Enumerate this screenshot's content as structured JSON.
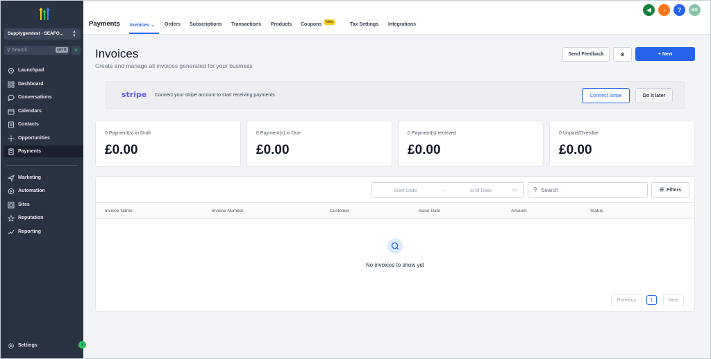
{
  "sidebar": {
    "location": "Supplygemtest - SEAFO...",
    "search_placeholder": "Search",
    "search_shortcut": "ctrl K",
    "items": [
      {
        "label": "Launchpad",
        "icon": "rocket-icon"
      },
      {
        "label": "Dashboard",
        "icon": "grid-icon"
      },
      {
        "label": "Conversations",
        "icon": "chat-icon"
      },
      {
        "label": "Calendars",
        "icon": "calendar-icon"
      },
      {
        "label": "Contacts",
        "icon": "contacts-icon"
      },
      {
        "label": "Opportunities",
        "icon": "opportunities-icon"
      },
      {
        "label": "Payments",
        "icon": "payments-icon",
        "active": true
      },
      {
        "label": "Marketing",
        "icon": "send-icon"
      },
      {
        "label": "Automation",
        "icon": "automation-icon"
      },
      {
        "label": "Sites",
        "icon": "sites-icon"
      },
      {
        "label": "Reputation",
        "icon": "star-icon"
      },
      {
        "label": "Reporting",
        "icon": "chart-line-icon"
      }
    ],
    "settings_label": "Settings"
  },
  "header": {
    "title": "Payments",
    "tabs": [
      "Invoices",
      "Orders",
      "Subscriptions",
      "Transactions",
      "Products",
      "Coupons",
      "Tax Settings",
      "Integrations"
    ],
    "new_badge": "New",
    "avatar_initials": "SG",
    "help_label": "?"
  },
  "page": {
    "title": "Invoices",
    "subtitle": "Create and manage all invoices generated for your business",
    "send_feedback": "Send Feedback",
    "new_button": "+ New"
  },
  "stripe": {
    "logo": "stripe",
    "text": "Connect your stripe account to start receiving payments",
    "connect": "Connect Stripe",
    "later": "Do it later"
  },
  "summary": [
    {
      "label": "0 Payment(s) in Draft",
      "value": "£0.00"
    },
    {
      "label": "0 Payment(s) in Due",
      "value": "£0.00"
    },
    {
      "label": "0 Payment(s) received",
      "value": "£0.00"
    },
    {
      "label": "0 Unpaid/Overdue",
      "value": "£0.00"
    }
  ],
  "table": {
    "start_date": "Start Date",
    "end_date": "End Date",
    "search_placeholder": "Search",
    "filters": "Filters",
    "columns": [
      "Invoice Name",
      "Invoice Number",
      "Customer",
      "Issue Date",
      "Amount",
      "Status"
    ],
    "empty_text": "No invoices to show yet",
    "pagination": {
      "previous": "Previous",
      "current": "1",
      "next": "Next"
    }
  },
  "colors": {
    "accent": "#2563eb",
    "sidebar": "#2a3342",
    "stripe": "#635bff"
  }
}
